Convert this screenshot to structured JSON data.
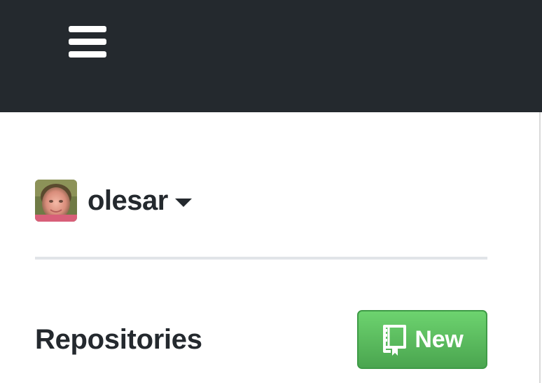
{
  "header": {
    "menu_icon": "hamburger-menu-icon"
  },
  "account": {
    "username": "olesar",
    "avatar_icon": "user-avatar",
    "caret_icon": "caret-down-icon"
  },
  "repositories": {
    "title": "Repositories",
    "new_button_label": "New",
    "new_button_icon": "repo-icon"
  },
  "colors": {
    "header_bg": "#24292e",
    "new_button_green": "#4aa54f",
    "text": "#24292e"
  }
}
